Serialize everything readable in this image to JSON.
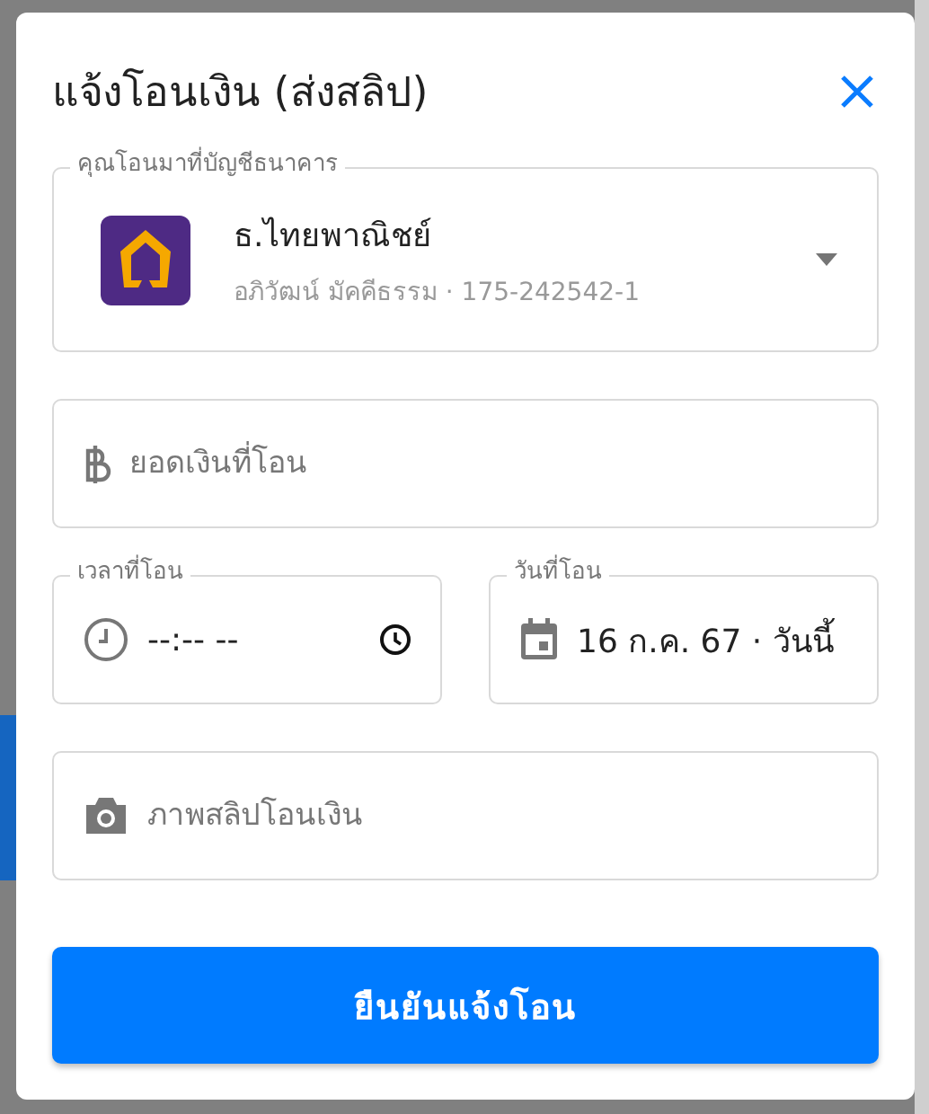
{
  "dialog": {
    "title": "แจ้งโอนเงิน (ส่งสลิป)",
    "bank_select": {
      "label": "คุณโอนมาที่บัญชีธนาคาร",
      "bank_name": "ธ.ไทยพาณิชย์",
      "account": "อภิวัฒน์ มัคคีธรรม · 175-242542-1"
    },
    "amount_field": {
      "placeholder": "ยอดเงินที่โอน"
    },
    "time_field": {
      "label": "เวลาที่โอน",
      "value": "--:-- --"
    },
    "date_field": {
      "label": "วันที่โอน",
      "value": "16 ก.ค. 67 · วันนี้"
    },
    "slip_field": {
      "placeholder": "ภาพสลิปโอนเงิน"
    },
    "submit_button": "ยืนยันแจ้งโอน"
  }
}
